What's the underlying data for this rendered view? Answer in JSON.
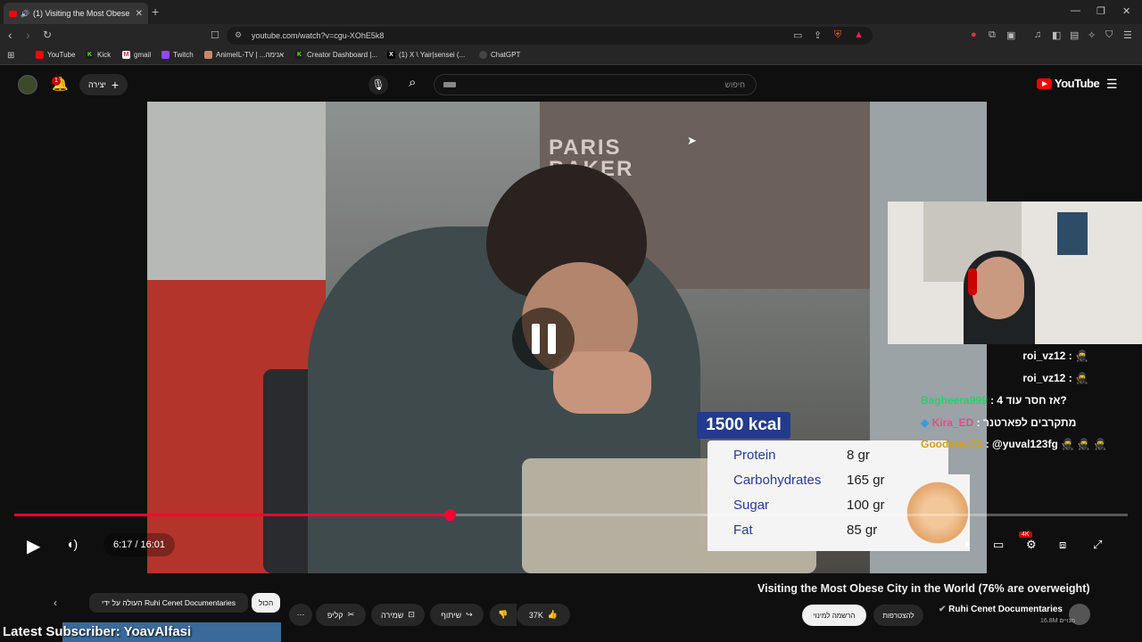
{
  "browser": {
    "tab_title": "(1) Visiting the Most Obese C",
    "url": "youtube.com/watch?v=cgu-XOhE5k8",
    "bookmarks": [
      {
        "label": "YouTube",
        "icon": "youtube-icon"
      },
      {
        "label": "Kick",
        "icon": "kick-icon"
      },
      {
        "label": "gmail",
        "icon": "gmail-icon"
      },
      {
        "label": "Twitch",
        "icon": "twitch-icon"
      },
      {
        "label": "AnimeIL-TV | ...אנימה",
        "icon": "animeil-icon"
      },
      {
        "label": "Creator Dashboard |...",
        "icon": "kick-icon"
      },
      {
        "label": "(1) X \\ Yair|sensei (...",
        "icon": "x-icon"
      },
      {
        "label": "ChatGPT",
        "icon": "chatgpt-icon"
      }
    ]
  },
  "youtube_header": {
    "notification_count": "1",
    "create_label": "יצירה",
    "search_placeholder": "חיפוש",
    "logo_text": "YouTube"
  },
  "player": {
    "time": "6:17 / 16:01",
    "progress_fraction": 0.391,
    "quality_badge": "4K",
    "state": "paused"
  },
  "overlay": {
    "kcal": "1500 kcal",
    "nutrition": [
      {
        "label": "Protein",
        "value": "8 gr"
      },
      {
        "label": "Carbohydrates",
        "value": "165 gr"
      },
      {
        "label": "Sugar",
        "value": "100 gr"
      },
      {
        "label": "Fat",
        "value": "85 gr"
      }
    ],
    "chat": [
      {
        "user": "roi_vz12",
        "text": ":",
        "color": "#ffffff"
      },
      {
        "user": "roi_vz12",
        "text": ":",
        "color": "#ffffff"
      },
      {
        "user": "Bagheera999",
        "text": ": אז חסר עוד 4?",
        "color": "#2ecc71"
      },
      {
        "user": "Kira_ED",
        "text": ": מתקרבים לפארטנר",
        "color": "#e74c8b"
      },
      {
        "user": "Goodman75",
        "text": ": @yuval123fg",
        "color": "#d4a017"
      }
    ]
  },
  "video_info": {
    "title": "Visiting the Most Obese City in the World (76% are overweight)",
    "channel": "Ruhi Cenet Documentaries",
    "subscribers": "16.8M מנויים",
    "join_label": "הרשמה למינוי",
    "subscribe_label": "להצטרפות",
    "likes": "37K",
    "share_label": "שיתוף",
    "save_label": "שמירה",
    "clip_label": "קליפ",
    "chip_uploaded": "העולה על ידי Ruhi Cenet Documentaries",
    "chip_all": "הכול"
  },
  "stream_overlay": {
    "latest_subscriber": "Latest Subscriber: YoavAlfasi"
  }
}
